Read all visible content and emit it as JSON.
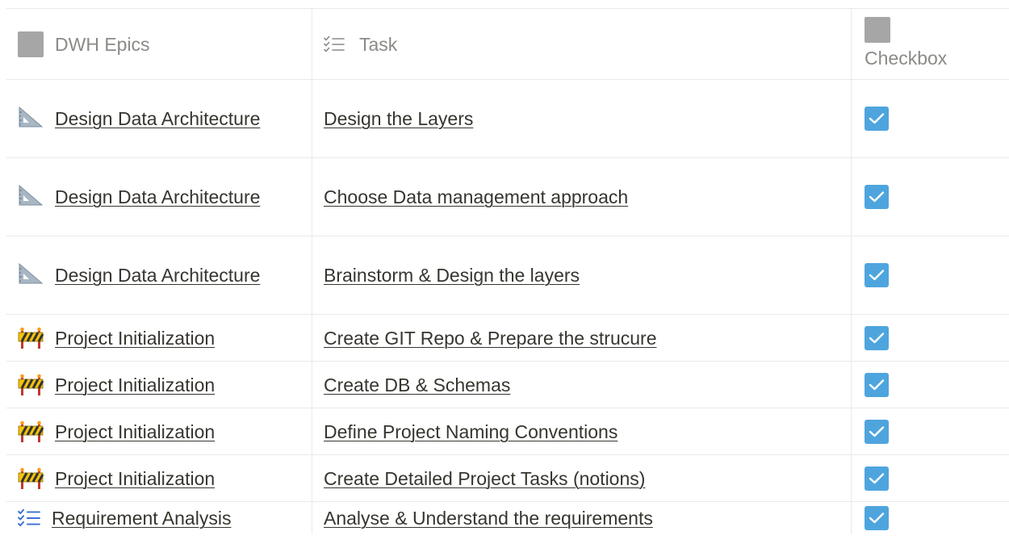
{
  "header": {
    "col_epics": "DWH Epics",
    "col_task": "Task",
    "col_checkbox": "Checkbox"
  },
  "rows": [
    {
      "epic": "Design Data Architecture",
      "epic_icon": "triangular-ruler-icon",
      "task": "Design the Layers",
      "checked": true
    },
    {
      "epic": "Design Data Architecture",
      "epic_icon": "triangular-ruler-icon",
      "task": "Choose Data management approach",
      "checked": true
    },
    {
      "epic": "Design Data Architecture",
      "epic_icon": "triangular-ruler-icon",
      "task": "Brainstorm & Design the layers",
      "checked": true
    },
    {
      "epic": "Project Initialization",
      "epic_icon": "construction-barrier-icon",
      "task": "Create GIT Repo & Prepare the strucure",
      "checked": true
    },
    {
      "epic": "Project Initialization",
      "epic_icon": "construction-barrier-icon",
      "task": "Create DB & Schemas",
      "checked": true
    },
    {
      "epic": "Project Initialization",
      "epic_icon": "construction-barrier-icon",
      "task": "Define Project Naming Conventions",
      "checked": true
    },
    {
      "epic": "Project Initialization",
      "epic_icon": "construction-barrier-icon",
      "task": "Create Detailed Project Tasks (notions)",
      "checked": true
    },
    {
      "epic": "Requirement Analysis",
      "epic_icon": "checklist-icon",
      "task": "Analyse & Understand the requirements",
      "checked": true
    }
  ],
  "colors": {
    "checkbox_fill": "#4ea5de",
    "header_text": "#8b8a86",
    "border": "#e9e9e7",
    "text": "#37352f"
  }
}
